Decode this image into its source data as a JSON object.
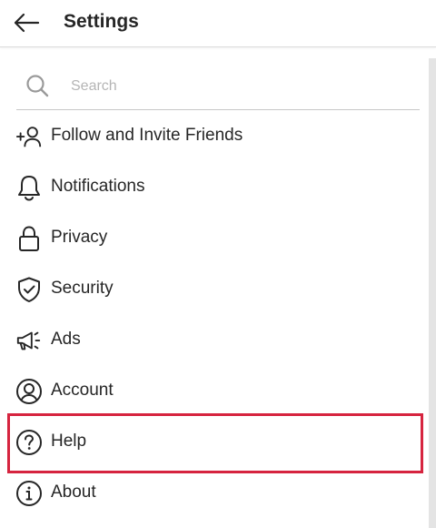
{
  "header": {
    "title": "Settings",
    "back_icon": "arrow-left-icon"
  },
  "search": {
    "placeholder": "Search",
    "value": "",
    "icon": "search-icon"
  },
  "menu": {
    "items": [
      {
        "label": "Follow and Invite Friends",
        "icon": "add-person-icon"
      },
      {
        "label": "Notifications",
        "icon": "bell-icon"
      },
      {
        "label": "Privacy",
        "icon": "lock-icon"
      },
      {
        "label": "Security",
        "icon": "shield-check-icon"
      },
      {
        "label": "Ads",
        "icon": "megaphone-icon"
      },
      {
        "label": "Account",
        "icon": "user-circle-icon"
      },
      {
        "label": "Help",
        "icon": "help-circle-icon",
        "highlighted": true
      },
      {
        "label": "About",
        "icon": "info-circle-icon"
      }
    ]
  },
  "colors": {
    "text": "#262626",
    "placeholder": "#b5b5b5",
    "highlight": "#d6243f",
    "divider": "#dbdbdb"
  }
}
